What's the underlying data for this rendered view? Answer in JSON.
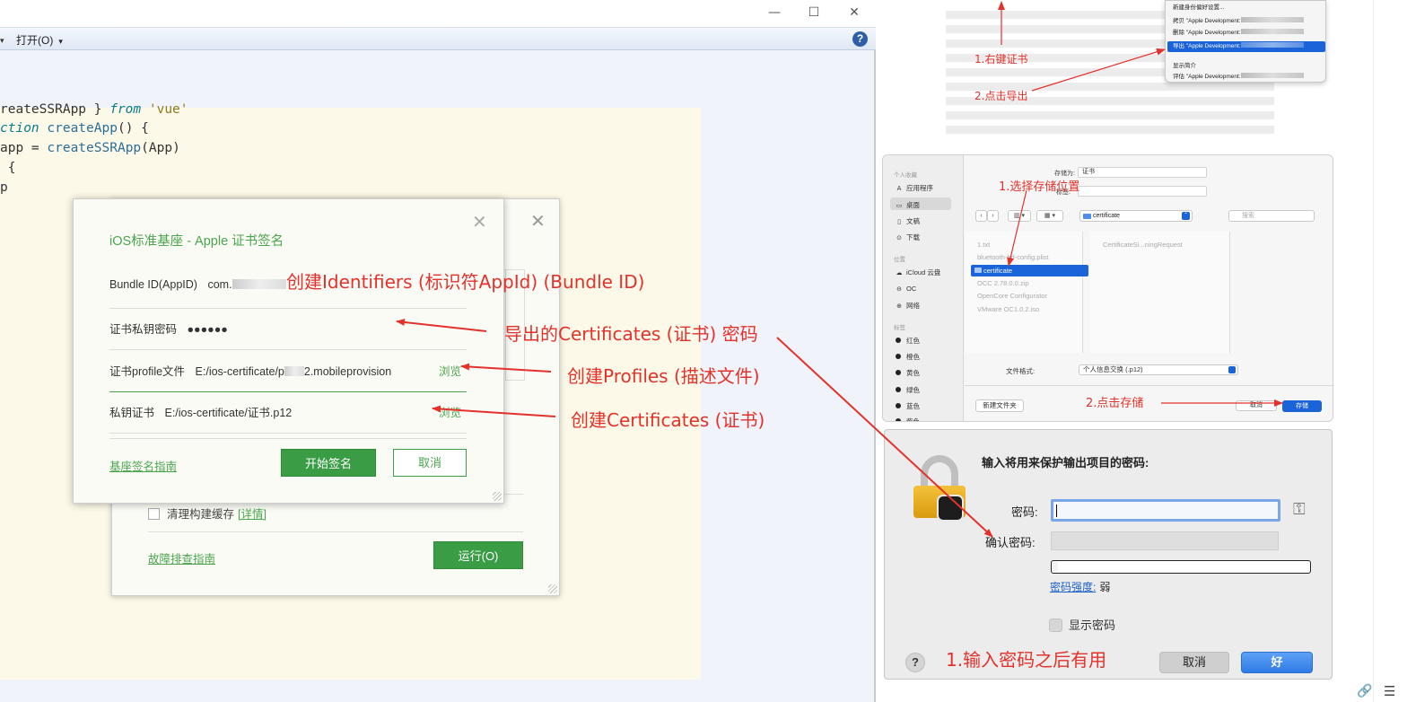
{
  "window": {
    "minimize": "—",
    "maximize": "☐",
    "close": "✕"
  },
  "menubar": {
    "left_caret": "▾",
    "open_label": "打开(O)",
    "open_caret": "▾",
    "help": "?"
  },
  "code": {
    "line1_a": "reateSSRApp } ",
    "line1_kw": "from",
    "line1_str": " 'vue'",
    "line2_kw": "ction",
    "line2_fn": " createApp",
    "line2_rest": "() {",
    "line3_a": "app = ",
    "line3_fn": "createSSRApp",
    "line3_rest": "(App)",
    "line4": " {",
    "line5": "p"
  },
  "run_dialog": {
    "close": "✕",
    "clean_cache_label": "清理构建缓存",
    "clean_cache_link": "[详情]",
    "trouble_link": "故障排查指南",
    "run_button": "运行(O)"
  },
  "sign_dialog": {
    "title": "iOS标准基座 - Apple 证书签名",
    "close": "✕",
    "bundle_label": "Bundle ID(AppID)",
    "bundle_value": "com.",
    "key_pw_label": "证书私钥密码",
    "key_pw_value": "●●●●●●",
    "profile_label": "证书profile文件",
    "profile_value": "E:/ios-certificate/p",
    "profile_value_end": "2.mobileprovision",
    "key_cert_label": "私钥证书",
    "key_cert_value": "E:/ios-certificate/证书.p12",
    "browse": "浏览",
    "guide_link": "基座签名指南",
    "start_button": "开始签名",
    "cancel_button": "取消"
  },
  "annotations": {
    "identifiers": "创建Identifiers (标识符AppId) (Bundle ID)",
    "certs_password": "导出的Certificates (证书) 密码",
    "profiles": "创建Profiles (描述文件)",
    "certificates": "创建Certificates (证书)",
    "right_click": "1.右键证书",
    "click_export": "2.点击导出",
    "choose_location": "1.选择存储位置",
    "click_save": "2.点击存储",
    "enter_password": "1.输入密码之后有用"
  },
  "context_menu": {
    "top": "新建身份偏好设置...",
    "copy": "拷贝 \"Apple Development:",
    "delete": "删除 \"Apple Development:",
    "export": "导出 \"Apple Development:",
    "show_info": "显示简介",
    "evaluate": "评估 \"Apple Development:"
  },
  "save_dialog": {
    "favorites": "个人收藏",
    "applications": "应用程序",
    "desktop": "桌面",
    "documents": "文稿",
    "downloads": "下载",
    "locations": "位置",
    "icloud": "iCloud 云盘",
    "oc": "OC",
    "network": "网络",
    "tags": "标签",
    "tag_red": "红色",
    "tag_orange": "橙色",
    "tag_yellow": "黄色",
    "tag_green": "绿色",
    "tag_blue": "蓝色",
    "tag_purple": "紫色",
    "save_as_label": "存储为:",
    "save_as_value": "证书",
    "tags_label": "标签:",
    "nav_back": "‹",
    "nav_fwd": "›",
    "view_columns": "▥ ▾",
    "view_grid": "▦ ▾",
    "path": "certificate",
    "search_placeholder": "搜索",
    "file1": "1.txt",
    "file2": "bluetooth-hd-config.plist",
    "file_cert": "certificate",
    "file4": "OCC 2.78.0.0.zip",
    "file5": "OpenCore Configurator",
    "file6": "VMware OC1.0.2.iso",
    "file_csr": "CertificateSi...ningRequest",
    "format_label": "文件格式:",
    "format_value": "个人信息交换 (.p12)",
    "new_folder": "新建文件夹",
    "cancel": "取消",
    "save": "存储"
  },
  "password_dialog": {
    "title": "输入将用来保护输出项目的密码:",
    "password_label": "密码:",
    "confirm_label": "确认密码:",
    "strength_link": "密码强度:",
    "strength_value": "弱",
    "strength_fraction": 0.02,
    "show_password": "显示密码",
    "help": "?",
    "cancel": "取消",
    "ok": "好",
    "key_icon": "⚿"
  },
  "page_icons": {
    "link": "🔗",
    "menu": "☰"
  }
}
